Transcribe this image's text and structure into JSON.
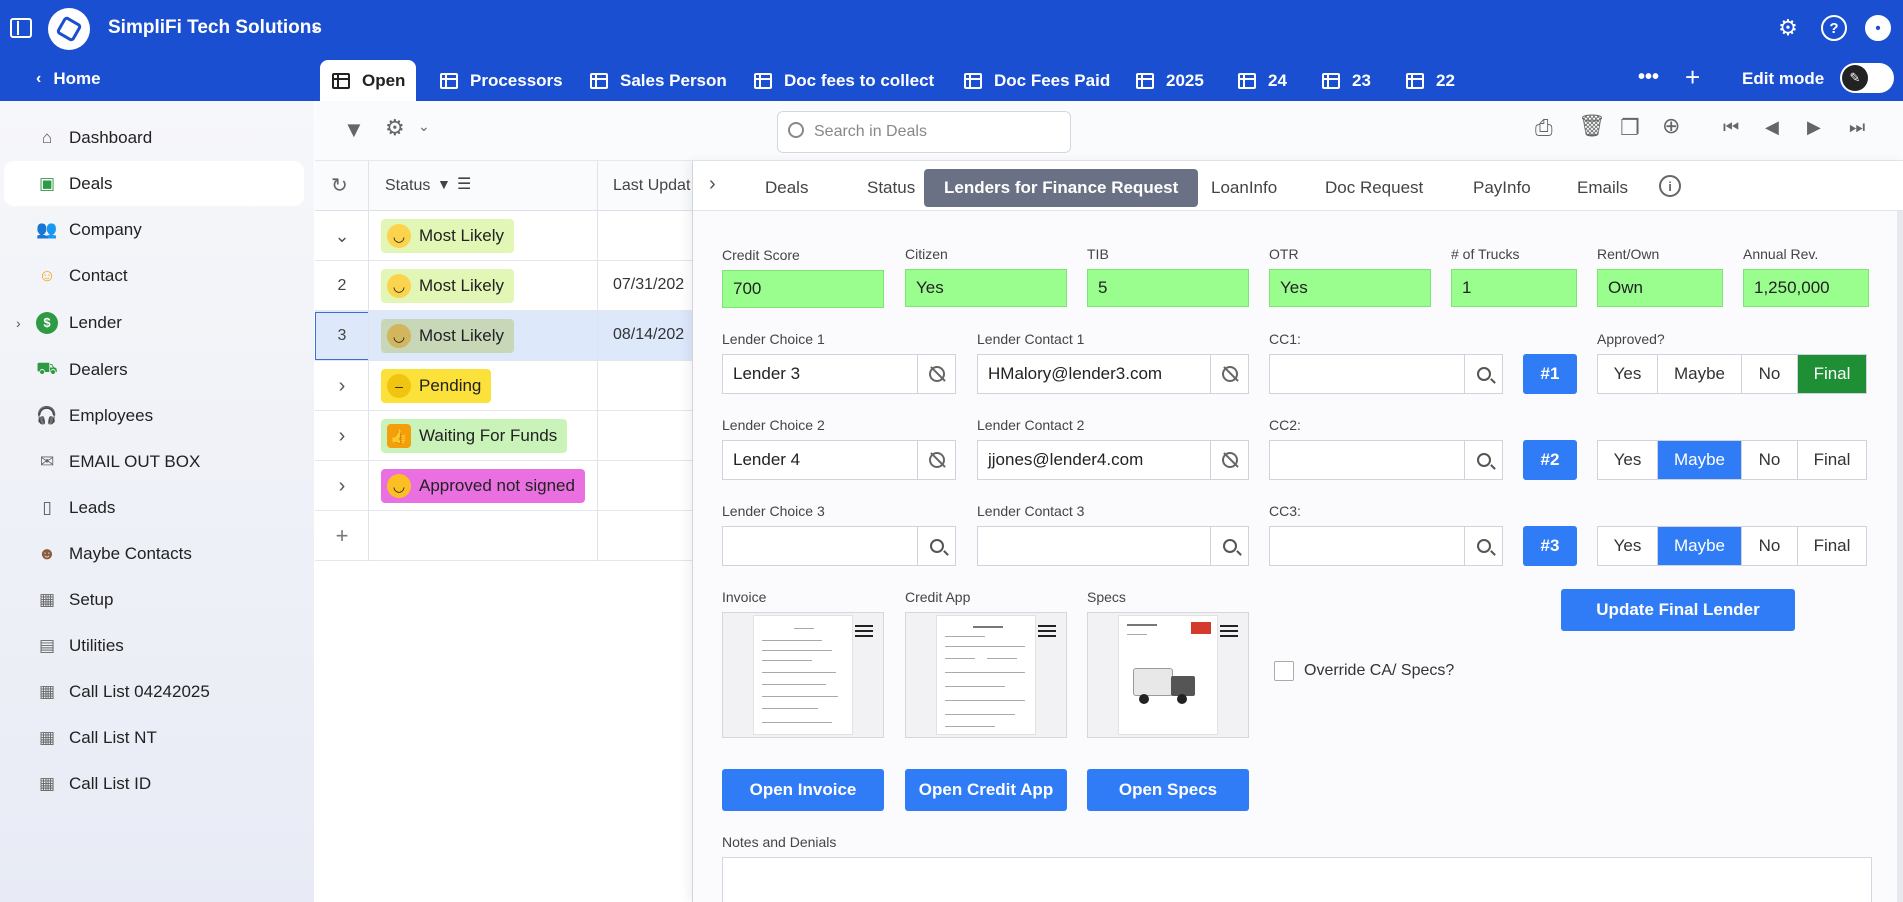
{
  "app": {
    "title": "SimpliFi Tech Solutions"
  },
  "nav": {
    "home": "Home",
    "edit_mode": "Edit mode",
    "more": "•••",
    "add": "+"
  },
  "view_tabs": [
    {
      "label": "Open"
    },
    {
      "label": "Processors"
    },
    {
      "label": "Sales Person"
    },
    {
      "label": "Doc fees to collect"
    },
    {
      "label": "Doc Fees Paid"
    },
    {
      "label": "2025"
    },
    {
      "label": "24"
    },
    {
      "label": "23"
    },
    {
      "label": "22"
    }
  ],
  "sidebar": {
    "items": [
      {
        "label": "Dashboard",
        "icon": "home-icon"
      },
      {
        "label": "Deals",
        "icon": "cash-icon"
      },
      {
        "label": "Company",
        "icon": "people-icon"
      },
      {
        "label": "Contact",
        "icon": "face-icon"
      },
      {
        "label": "Lender",
        "icon": "dollar-icon"
      },
      {
        "label": "Dealers",
        "icon": "truck-icon"
      },
      {
        "label": "Employees",
        "icon": "headset-icon"
      },
      {
        "label": "EMAIL OUT BOX",
        "icon": "mail-icon"
      },
      {
        "label": "Leads",
        "icon": "phone-icon"
      },
      {
        "label": "Maybe Contacts",
        "icon": "face-icon"
      },
      {
        "label": "Setup",
        "icon": "table-icon"
      },
      {
        "label": "Utilities",
        "icon": "document-icon"
      },
      {
        "label": "Call List 04242025",
        "icon": "table-icon"
      },
      {
        "label": "Call List NT",
        "icon": "table-icon"
      },
      {
        "label": "Call List ID",
        "icon": "table-icon"
      }
    ]
  },
  "search": {
    "placeholder": "Search in Deals"
  },
  "grid": {
    "headers": {
      "status": "Status",
      "last_updated": "Last Updat"
    },
    "rows": [
      {
        "num": "",
        "status": "Most Likely",
        "date": ""
      },
      {
        "num": "2",
        "status": "Most Likely",
        "date": "07/31/202"
      },
      {
        "num": "3",
        "status": "Most Likely",
        "date": "08/14/202"
      },
      {
        "num": "",
        "status": "Pending",
        "date": ""
      },
      {
        "num": "",
        "status": "Waiting For Funds",
        "date": ""
      },
      {
        "num": "",
        "status": "Approved not signed",
        "date": ""
      }
    ],
    "add": "+"
  },
  "detail": {
    "tabs": [
      {
        "label": "Deals"
      },
      {
        "label": "Status"
      },
      {
        "label": "Lenders for Finance Request"
      },
      {
        "label": "LoanInfo"
      },
      {
        "label": "Doc Request"
      },
      {
        "label": "PayInfo"
      },
      {
        "label": "Emails"
      }
    ],
    "summary": [
      {
        "label": "Credit Score",
        "value": "700"
      },
      {
        "label": "Citizen",
        "value": "Yes"
      },
      {
        "label": "TIB",
        "value": "5"
      },
      {
        "label": "OTR",
        "value": "Yes"
      },
      {
        "label": "# of Trucks",
        "value": "1"
      },
      {
        "label": "Rent/Own",
        "value": "Own"
      },
      {
        "label": "Annual Rev.",
        "value": "1,250,000"
      }
    ],
    "lenders": [
      {
        "choice_label": "Lender Choice 1",
        "choice": "Lender 3",
        "contact_label": "Lender Contact 1",
        "contact": "HMalory@lender3.com",
        "cc_label": "CC1:",
        "num": "#1"
      },
      {
        "choice_label": "Lender Choice 2",
        "choice": "Lender 4",
        "contact_label": "Lender Contact 2",
        "contact": "jjones@lender4.com",
        "cc_label": "CC2:",
        "num": "#2"
      },
      {
        "choice_label": "Lender Choice 3",
        "choice": "",
        "contact_label": "Lender Contact 3",
        "contact": "",
        "cc_label": "CC3:",
        "num": "#3"
      }
    ],
    "approved_label": "Approved?",
    "approval_options": [
      "Yes",
      "Maybe",
      "No",
      "Final"
    ],
    "approval_selected": [
      "Final",
      "Maybe",
      "Maybe"
    ],
    "update_button": "Update Final Lender",
    "docs": [
      {
        "label": "Invoice",
        "button": "Open Invoice"
      },
      {
        "label": "Credit App",
        "button": "Open Credit App"
      },
      {
        "label": "Specs",
        "button": "Open Specs"
      }
    ],
    "override_label": "Override CA/ Specs?",
    "notes_label": "Notes and Denials"
  },
  "colors": {
    "brand": "#1b4fd1",
    "field_green": "#9afe8f",
    "accent_blue": "#2f7cf6",
    "final_green": "#1e8f34",
    "pill_most_likely": "#e2f7b5",
    "pill_pending": "#fbe13a",
    "pill_waiting": "#c9f3b8",
    "pill_approved": "#ea6fe0"
  }
}
